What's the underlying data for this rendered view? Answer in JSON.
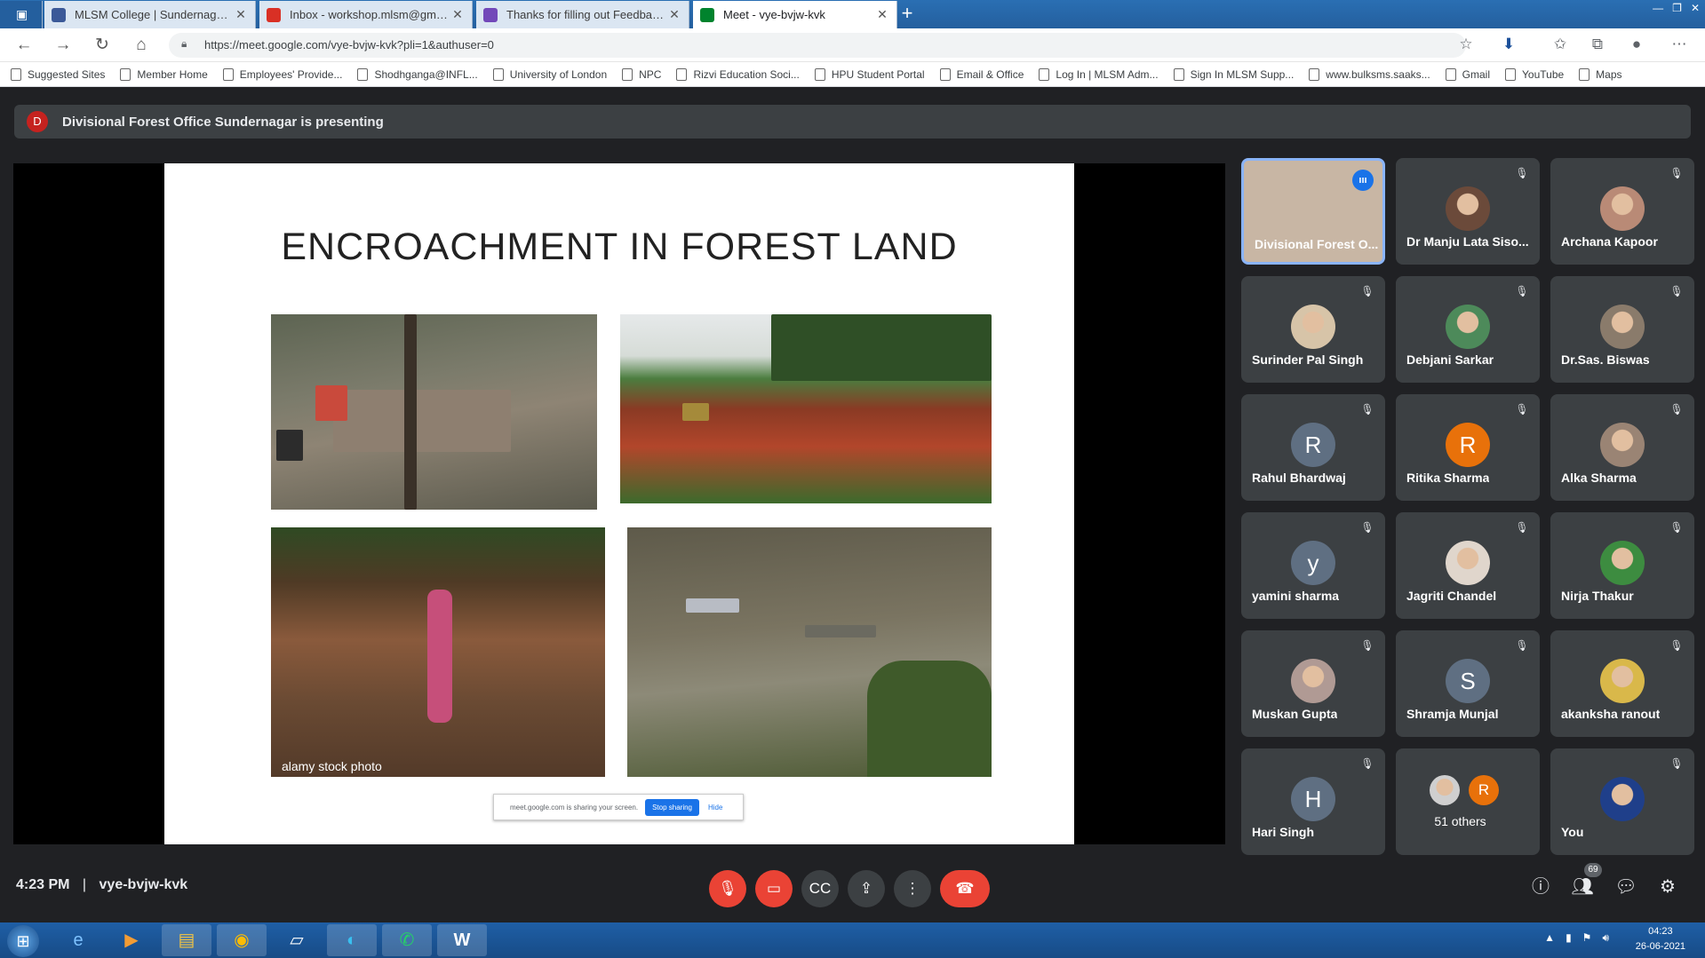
{
  "browser": {
    "tabs": [
      {
        "title": "MLSM College | Sundernagar, M...",
        "color": "#3b5998",
        "active": false
      },
      {
        "title": "Inbox - workshop.mlsm@gmail.c...",
        "color": "#d93025",
        "active": false
      },
      {
        "title": "Thanks for filling out Feedback f...",
        "color": "#7248b9",
        "active": false
      },
      {
        "title": "Meet - vye-bvjw-kvk",
        "color": "#00832d",
        "active": true
      }
    ],
    "url": "https://meet.google.com/vye-bvjw-kvk?pli=1&authuser=0",
    "bookmarks": [
      "Suggested Sites",
      "Member Home",
      "Employees' Provide...",
      "Shodhganga@INFL...",
      "University of London",
      "NPC",
      "Rizvi Education Soci...",
      "HPU Student Portal",
      "Email & Office",
      "Log In | MLSM Adm...",
      "Sign In MLSM Supp...",
      "www.bulksms.saaks...",
      "Gmail",
      "YouTube",
      "Maps"
    ]
  },
  "meet": {
    "presenter_initial": "D",
    "presenting_text": "Divisional Forest Office Sundernagar is presenting",
    "slide": {
      "title": "ENCROACHMENT IN FOREST LAND",
      "watermark": "alamy stock photo",
      "share_notice": "meet.google.com is sharing your screen.",
      "stop_sharing": "Stop sharing",
      "hide": "Hide"
    },
    "participants": [
      {
        "name": "Divisional Forest O...",
        "speaking": true,
        "kind": "video"
      },
      {
        "name": "Dr Manju Lata Siso...",
        "kind": "photo",
        "color": "#6b4a3a"
      },
      {
        "name": "Archana Kapoor",
        "kind": "photo",
        "color": "#b98a76"
      },
      {
        "name": "Surinder Pal Singh",
        "kind": "photo",
        "color": "#d7c4a8"
      },
      {
        "name": "Debjani Sarkar",
        "kind": "photo",
        "color": "#4d8a5a"
      },
      {
        "name": "Dr.Sas. Biswas",
        "kind": "photo",
        "color": "#8a7b6b"
      },
      {
        "name": "Rahul Bhardwaj",
        "kind": "letter",
        "letter": "R",
        "color": "#5f6f82"
      },
      {
        "name": "Ritika Sharma",
        "kind": "letter",
        "letter": "R",
        "color": "#e8710a"
      },
      {
        "name": "Alka Sharma",
        "kind": "photo",
        "color": "#9a8474"
      },
      {
        "name": "yamini sharma",
        "kind": "letter",
        "letter": "y",
        "color": "#5f6f82"
      },
      {
        "name": "Jagriti Chandel",
        "kind": "photo",
        "color": "#e0d6cc"
      },
      {
        "name": "Nirja Thakur",
        "kind": "photo",
        "color": "#3d8c40"
      },
      {
        "name": "Muskan Gupta",
        "kind": "photo",
        "color": "#b09a94"
      },
      {
        "name": "Shramja Munjal",
        "kind": "letter",
        "letter": "S",
        "color": "#5f6f82"
      },
      {
        "name": "akanksha ranout",
        "kind": "photo",
        "color": "#d9b84a"
      },
      {
        "name": "Hari Singh",
        "kind": "letter",
        "letter": "H",
        "color": "#5f6f82"
      },
      {
        "name": "51 others",
        "kind": "others",
        "color": "#e8710a",
        "letter": "R"
      },
      {
        "name": "You",
        "kind": "photo",
        "color": "#1f3f8a"
      }
    ],
    "time": "4:23 PM",
    "meeting_code": "vye-bvjw-kvk",
    "people_count": "69"
  },
  "taskbar": {
    "time": "04:23",
    "date": "26-06-2021"
  }
}
